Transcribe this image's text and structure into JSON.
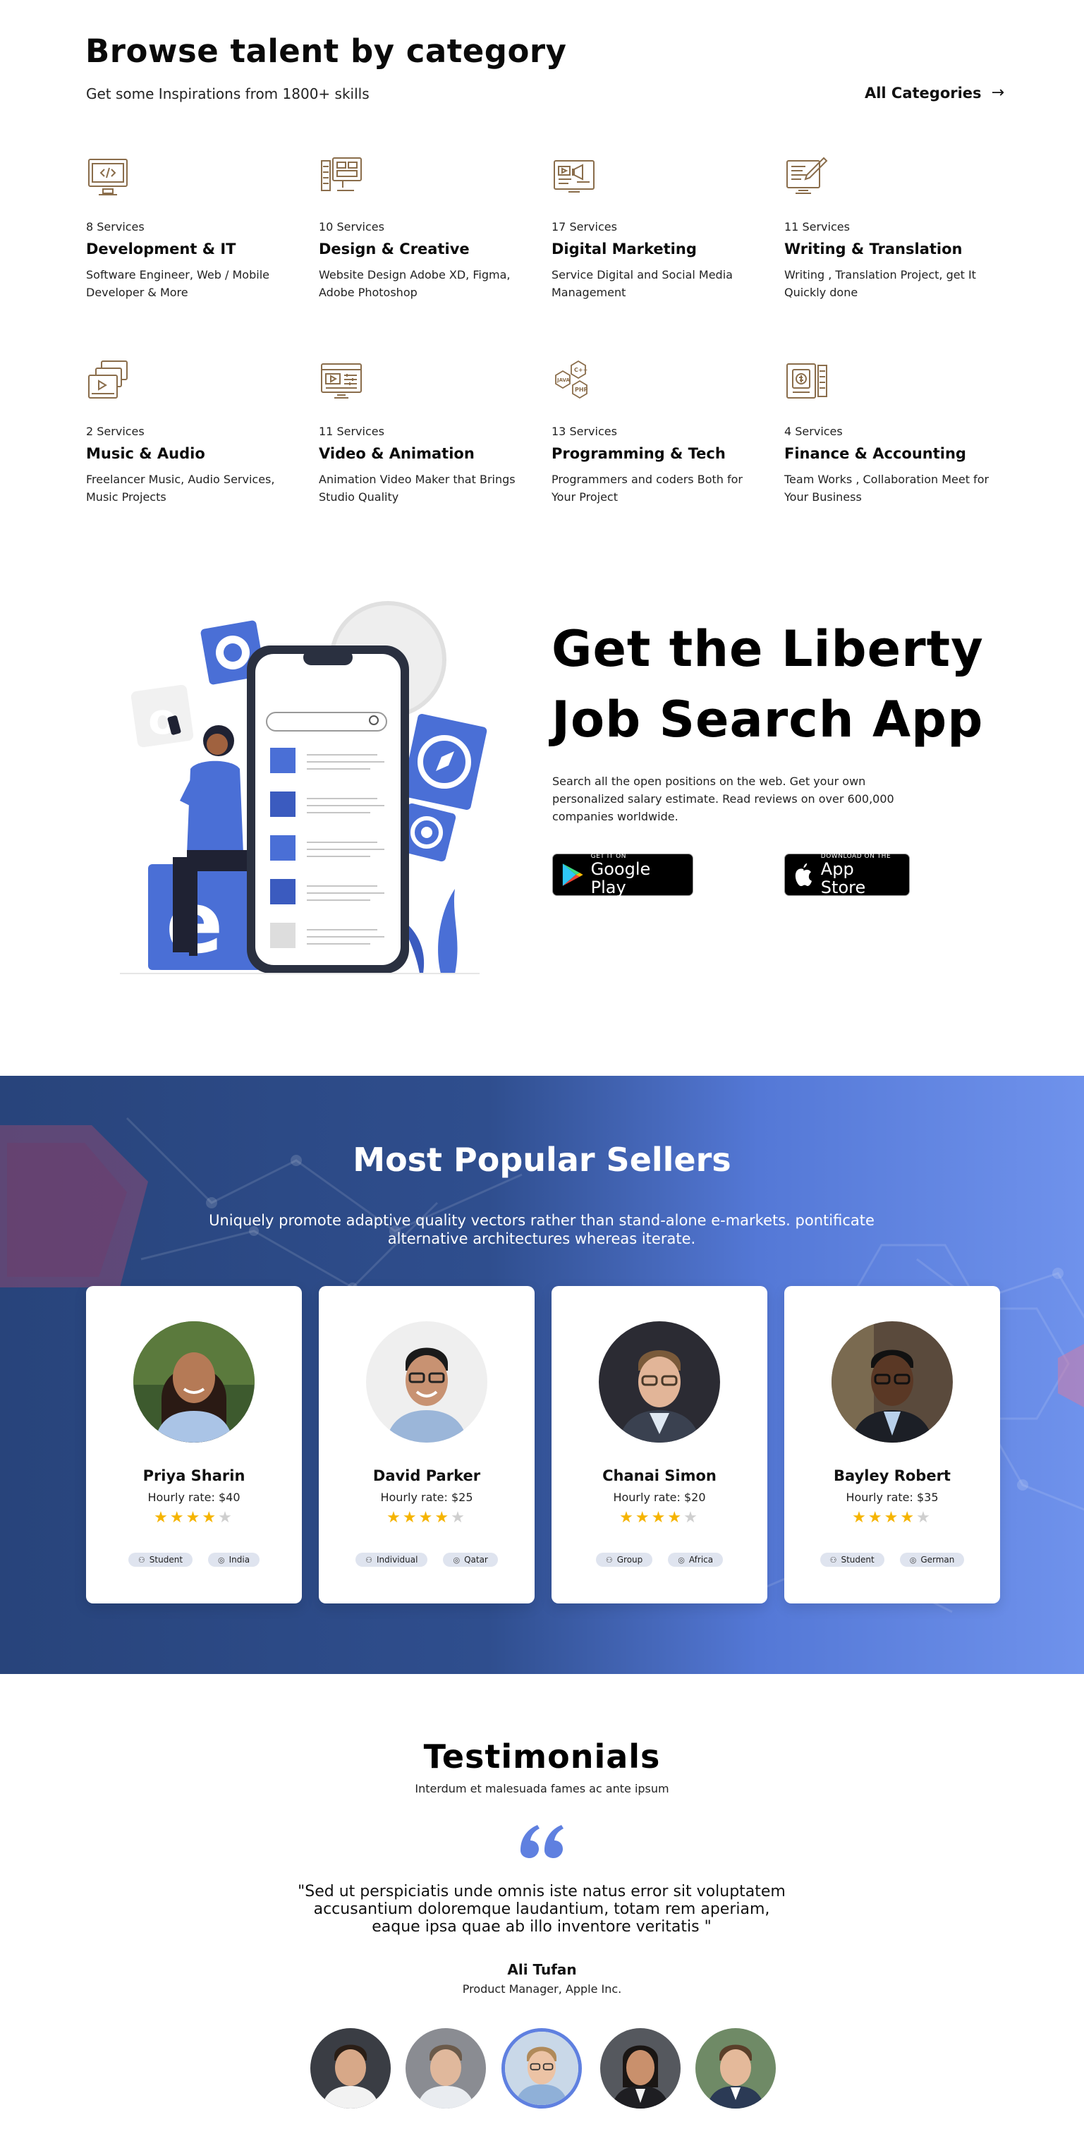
{
  "browse": {
    "title": "Browse talent by category",
    "subtitle": "Get some Inspirations from 1800+ skills",
    "all_categories": "All Categories",
    "categories": [
      {
        "services": "8 Services",
        "name": "Development & IT",
        "desc": "Software Engineer, Web / Mobile Developer & More",
        "icon": "code-monitor-icon"
      },
      {
        "services": "10 Services",
        "name": "Design & Creative",
        "desc": "Website Design Adobe XD, Figma, Adobe Photoshop",
        "icon": "design-tools-icon"
      },
      {
        "services": "17 Services",
        "name": "Digital Marketing",
        "desc": "Service Digital and Social Media Management",
        "icon": "megaphone-screen-icon"
      },
      {
        "services": "11 Services",
        "name": "Writing & Translation",
        "desc": "Writing , Translation Project, get It Quickly done",
        "icon": "pen-document-icon"
      },
      {
        "services": "2 Services",
        "name": "Music & Audio",
        "desc": "Freelancer Music, Audio Services, Music Projects",
        "icon": "music-player-icon"
      },
      {
        "services": "11 Services",
        "name": "Video & Animation",
        "desc": "Animation Video Maker that Brings Studio Quality",
        "icon": "video-editor-icon"
      },
      {
        "services": "13 Services",
        "name": "Programming & Tech",
        "desc": "Programmers and coders Both for Your Project",
        "icon": "languages-hexagon-icon"
      },
      {
        "services": "4 Services",
        "name": "Finance & Accounting",
        "desc": "Team Works , Collaboration Meet for Your Business",
        "icon": "finance-tablet-icon"
      }
    ]
  },
  "app": {
    "title_line1": "Get the Liberty",
    "title_line2": "Job Search App",
    "description": "Search all the open positions on the web. Get your own personalized salary estimate. Read reviews on over 600,000 companies worldwide.",
    "google_play": {
      "small": "GET IT ON",
      "big": "Google Play"
    },
    "app_store": {
      "small": "DOWNLOAD ON THE",
      "big": "App Store"
    }
  },
  "sellers": {
    "title": "Most Popular Sellers",
    "subtitle": "Uniquely promote adaptive quality vectors rather than stand-alone e-markets. pontificate alternative architectures whereas iterate.",
    "items": [
      {
        "name": "Priya Sharin",
        "rate": "Hourly rate: $40",
        "rating": 4,
        "tag1": "Student",
        "tag2": "India"
      },
      {
        "name": "David Parker",
        "rate": "Hourly rate: $25",
        "rating": 4,
        "tag1": "Individual",
        "tag2": "Qatar"
      },
      {
        "name": "Chanai Simon",
        "rate": "Hourly rate: $20",
        "rating": 4,
        "tag1": "Group",
        "tag2": "Africa"
      },
      {
        "name": "Bayley Robert",
        "rate": "Hourly rate: $35",
        "rating": 4,
        "tag1": "Student",
        "tag2": "German"
      }
    ]
  },
  "testimonials": {
    "title": "Testimonials",
    "subtitle": "Interdum et malesuada fames ac ante ipsum",
    "quote": "\"Sed ut perspiciatis unde omnis iste natus error sit voluptatem accusantium doloremque laudantium, totam rem aperiam, eaque ipsa quae ab illo inventore veritatis \"",
    "author": "Ali Tufan",
    "role": "Product Manager, Apple Inc."
  },
  "colors": {
    "accent": "#5f80e0",
    "icon_outline": "#8a6d4b",
    "star": "#f5b400",
    "sellers_gradient_start": "#28447b",
    "sellers_gradient_end": "#6f92ec"
  }
}
